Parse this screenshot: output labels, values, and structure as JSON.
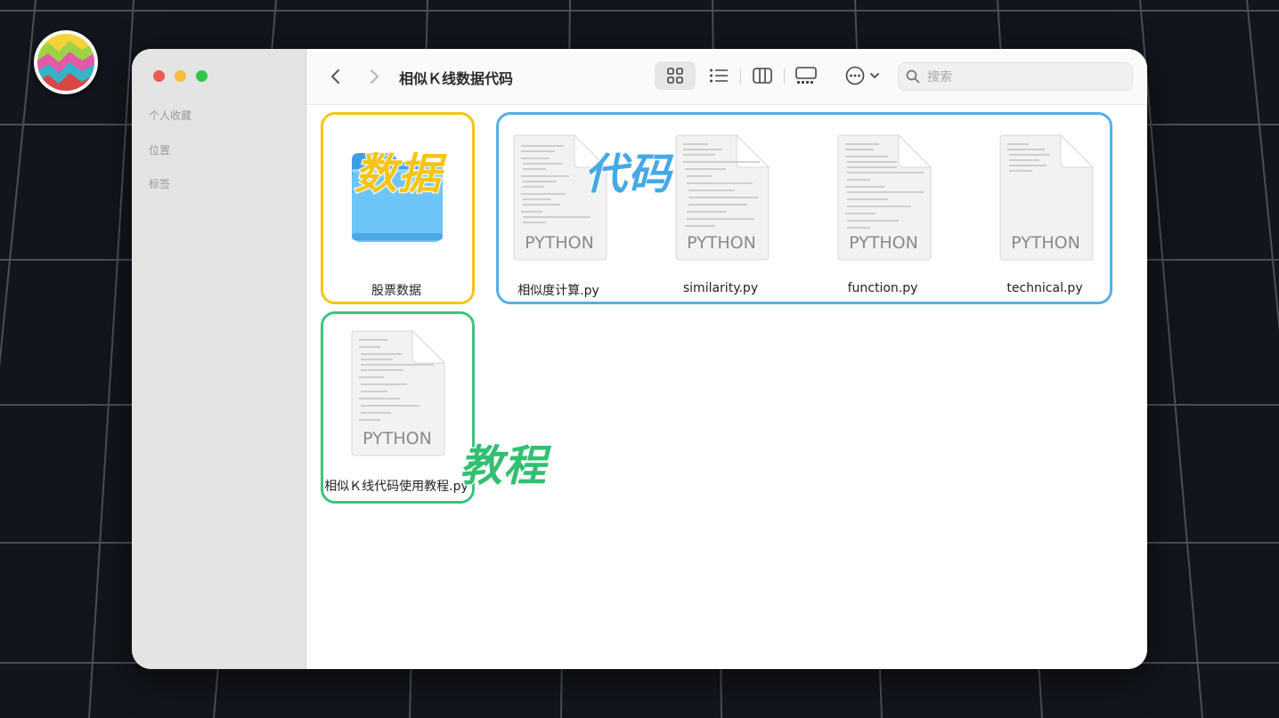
{
  "window": {
    "title": "相似Ｋ线数据代码"
  },
  "sidebar": {
    "items": [
      {
        "label": "个人收藏"
      },
      {
        "label": "位置"
      },
      {
        "label": "标签"
      }
    ]
  },
  "toolbar": {
    "back_icon": "chevron-left-icon",
    "forward_icon": "chevron-right-icon",
    "view_modes": [
      "icon-view-icon",
      "list-view-icon",
      "column-view-icon",
      "gallery-view-icon"
    ],
    "more_icon": "ellipsis-circle-icon",
    "search_placeholder": "搜索"
  },
  "annotations": {
    "data": {
      "text": "数据",
      "color": "#f5c419"
    },
    "code": {
      "text": "代码",
      "color": "#47a8e6"
    },
    "tutorial": {
      "text": "教程",
      "color": "#33bf72"
    }
  },
  "files": {
    "folder": {
      "name": "股票数据",
      "kind": "folder"
    },
    "code": [
      {
        "name": "相似度计算.py",
        "badge": "PYTHON"
      },
      {
        "name": "similarity.py",
        "badge": "PYTHON"
      },
      {
        "name": "function.py",
        "badge": "PYTHON"
      },
      {
        "name": "technical.py",
        "badge": "PYTHON"
      }
    ],
    "tutorial": {
      "name": "相似Ｋ线代码使用教程.py",
      "badge": "PYTHON"
    }
  },
  "colors": {
    "background": "#12151c",
    "sidebar": "#e4e4e4",
    "data_box": "#f5c419",
    "code_box": "#56aee5",
    "tutorial_box": "#3fc27d",
    "folder": "#6cc4f7"
  }
}
